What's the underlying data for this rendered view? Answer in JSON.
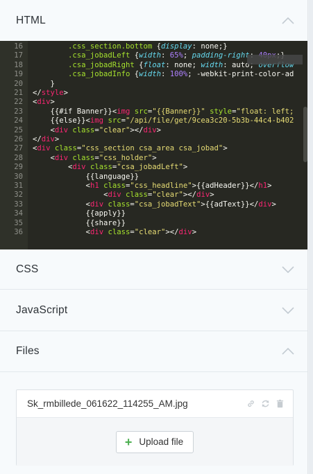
{
  "panels": {
    "html": {
      "title": "HTML",
      "expanded": true
    },
    "css": {
      "title": "CSS",
      "expanded": false
    },
    "javascript": {
      "title": "JavaScript",
      "expanded": false
    },
    "files": {
      "title": "Files",
      "expanded": true
    }
  },
  "editor": {
    "fold_tooltip": "ƒ",
    "lines": [
      {
        "n": "16",
        "indent": "        ",
        "tokens": [
          [
            "sel",
            ".css_section.bottom"
          ],
          [
            "plain",
            " {"
          ],
          [
            "prop",
            "display"
          ],
          [
            "plain",
            ": none;}"
          ]
        ]
      },
      {
        "n": "17",
        "indent": "        ",
        "tokens": [
          [
            "sel",
            ".csa_jobadLeft"
          ],
          [
            "plain",
            " {"
          ],
          [
            "prop",
            "width"
          ],
          [
            "plain",
            ": "
          ],
          [
            "num",
            "65%"
          ],
          [
            "plain",
            "; "
          ],
          [
            "prop",
            "padding-right"
          ],
          [
            "plain",
            ": "
          ],
          [
            "num",
            "40px"
          ],
          [
            "plain",
            ";}"
          ]
        ]
      },
      {
        "n": "18",
        "indent": "        ",
        "tokens": [
          [
            "sel",
            ".csa_jobadRight"
          ],
          [
            "plain",
            " {"
          ],
          [
            "prop",
            "float"
          ],
          [
            "plain",
            ": none; "
          ],
          [
            "prop",
            "width"
          ],
          [
            "plain",
            ": auto; "
          ],
          [
            "prop",
            "overflow"
          ]
        ]
      },
      {
        "n": "19",
        "indent": "        ",
        "tokens": [
          [
            "sel",
            ".csa_jobadInfo"
          ],
          [
            "plain",
            " {"
          ],
          [
            "prop",
            "width"
          ],
          [
            "plain",
            ": "
          ],
          [
            "num",
            "100%"
          ],
          [
            "plain",
            "; -webkit-print-color-ad"
          ]
        ]
      },
      {
        "n": "20",
        "indent": "    ",
        "tokens": [
          [
            "plain",
            "}"
          ]
        ]
      },
      {
        "n": "21",
        "indent": "",
        "tokens": [
          [
            "plain",
            "</"
          ],
          [
            "tag",
            "style"
          ],
          [
            "plain",
            ">"
          ]
        ]
      },
      {
        "n": "22",
        "indent": "",
        "tokens": [
          [
            "plain",
            "<"
          ],
          [
            "tag",
            "div"
          ],
          [
            "plain",
            ">"
          ]
        ]
      },
      {
        "n": "23",
        "indent": "    ",
        "tokens": [
          [
            "plain",
            "{{#if Banner}}<"
          ],
          [
            "tag",
            "img"
          ],
          [
            "attr",
            " src"
          ],
          [
            "plain",
            "="
          ],
          [
            "str",
            "\"{{Banner}}\""
          ],
          [
            "attr",
            " style"
          ],
          [
            "plain",
            "="
          ],
          [
            "str",
            "\"float: left;"
          ]
        ]
      },
      {
        "n": "24",
        "indent": "    ",
        "tokens": [
          [
            "plain",
            "{{else}}<"
          ],
          [
            "tag",
            "img"
          ],
          [
            "attr",
            " src"
          ],
          [
            "plain",
            "="
          ],
          [
            "str",
            "\"/api/file/get/9cea3c20-5b3b-44c4-b402"
          ]
        ]
      },
      {
        "n": "25",
        "indent": "    ",
        "tokens": [
          [
            "plain",
            "<"
          ],
          [
            "tag",
            "div"
          ],
          [
            "attr",
            " class"
          ],
          [
            "plain",
            "="
          ],
          [
            "str",
            "\"clear\""
          ],
          [
            "plain",
            "></"
          ],
          [
            "tag",
            "div"
          ],
          [
            "plain",
            ">"
          ]
        ]
      },
      {
        "n": "26",
        "indent": "",
        "tokens": [
          [
            "plain",
            "</"
          ],
          [
            "tag",
            "div"
          ],
          [
            "plain",
            ">"
          ]
        ]
      },
      {
        "n": "27",
        "indent": "",
        "tokens": [
          [
            "plain",
            "<"
          ],
          [
            "tag",
            "div"
          ],
          [
            "attr",
            " class"
          ],
          [
            "plain",
            "="
          ],
          [
            "str",
            "\"css_section csa_area csa_jobad\""
          ],
          [
            "plain",
            ">"
          ]
        ]
      },
      {
        "n": "28",
        "indent": "    ",
        "tokens": [
          [
            "plain",
            "<"
          ],
          [
            "tag",
            "div"
          ],
          [
            "attr",
            " class"
          ],
          [
            "plain",
            "="
          ],
          [
            "str",
            "\"css_holder\""
          ],
          [
            "plain",
            ">"
          ]
        ]
      },
      {
        "n": "29",
        "indent": "        ",
        "tokens": [
          [
            "plain",
            "<"
          ],
          [
            "tag",
            "div"
          ],
          [
            "attr",
            " class"
          ],
          [
            "plain",
            "="
          ],
          [
            "str",
            "\"csa_jobadLeft\""
          ],
          [
            "plain",
            ">"
          ]
        ]
      },
      {
        "n": "30",
        "indent": "            ",
        "tokens": [
          [
            "plain",
            "{{language}}"
          ]
        ]
      },
      {
        "n": "31",
        "indent": "            ",
        "tokens": [
          [
            "plain",
            "<"
          ],
          [
            "tag",
            "h1"
          ],
          [
            "attr",
            " class"
          ],
          [
            "plain",
            "="
          ],
          [
            "str",
            "\"css_headline\""
          ],
          [
            "plain",
            ">{{adHeader}}</"
          ],
          [
            "tag",
            "h1"
          ],
          [
            "plain",
            ">"
          ]
        ]
      },
      {
        "n": "32",
        "indent": "                ",
        "tokens": [
          [
            "plain",
            "<"
          ],
          [
            "tag",
            "div"
          ],
          [
            "attr",
            " class"
          ],
          [
            "plain",
            "="
          ],
          [
            "str",
            "\"clear\""
          ],
          [
            "plain",
            "></"
          ],
          [
            "tag",
            "div"
          ],
          [
            "plain",
            ">"
          ]
        ]
      },
      {
        "n": "33",
        "indent": "            ",
        "tokens": [
          [
            "plain",
            "<"
          ],
          [
            "tag",
            "div"
          ],
          [
            "attr",
            " class"
          ],
          [
            "plain",
            "="
          ],
          [
            "str",
            "\"csa_jobadText\""
          ],
          [
            "plain",
            ">{{adText}}</"
          ],
          [
            "tag",
            "div"
          ],
          [
            "plain",
            ">"
          ]
        ]
      },
      {
        "n": "34",
        "indent": "            ",
        "tokens": [
          [
            "plain",
            "{{apply}}"
          ]
        ]
      },
      {
        "n": "35",
        "indent": "            ",
        "tokens": [
          [
            "plain",
            "{{share}}"
          ]
        ]
      },
      {
        "n": "36",
        "indent": "            ",
        "tokens": [
          [
            "plain",
            "<"
          ],
          [
            "tag",
            "div"
          ],
          [
            "attr",
            " class"
          ],
          [
            "plain",
            "="
          ],
          [
            "str",
            "\"clear\""
          ],
          [
            "plain",
            "></"
          ],
          [
            "tag",
            "div"
          ],
          [
            "plain",
            ">"
          ]
        ]
      }
    ]
  },
  "files": {
    "items": [
      {
        "name": "Sk_rmbillede_061622_114255_AM.jpg"
      }
    ],
    "upload_label": "Upload file"
  },
  "icons": {
    "chevron_up": "chevron-up-icon",
    "chevron_down": "chevron-down-icon",
    "link": "link-icon",
    "refresh": "refresh-icon",
    "trash": "trash-icon",
    "plus": "plus-icon"
  },
  "colors": {
    "editor_bg": "#272822",
    "tag": "#f92672",
    "attribute": "#a6e22e",
    "string": "#e6db74",
    "property": "#66d9ef",
    "number": "#ae81ff",
    "accent_green": "#4caf50"
  }
}
